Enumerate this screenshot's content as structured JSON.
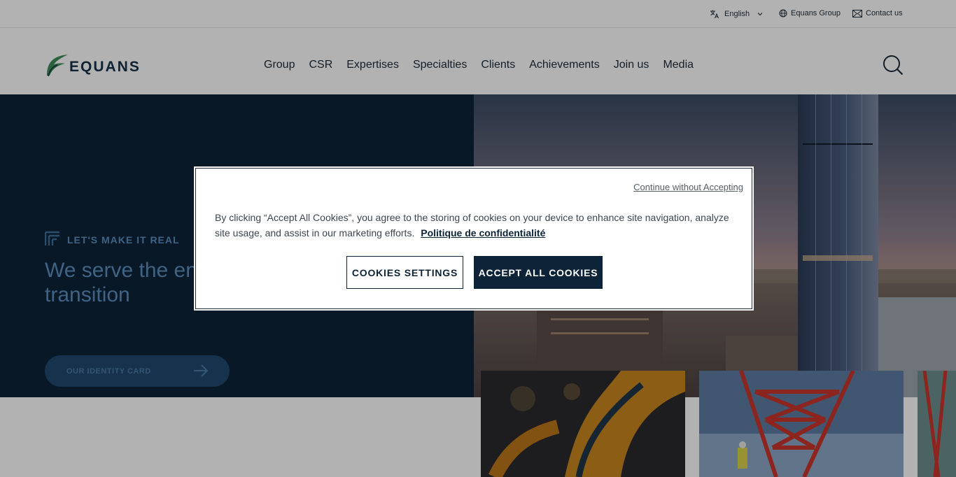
{
  "utility": {
    "language": "English",
    "group": "Equans Group",
    "contact": "Contact us"
  },
  "brand": {
    "name": "EQUANS",
    "green": "#3f8f5a",
    "navy": "#0d2338"
  },
  "nav": {
    "items": [
      "Group",
      "CSR",
      "Expertises",
      "Specialties",
      "Clients",
      "Achievements",
      "Join us",
      "Media"
    ]
  },
  "hero": {
    "tag": "LET'S MAKE IT REAL",
    "title": "We serve the energy and industrial transition",
    "cta": "OUR IDENTITY CARD"
  },
  "cookie": {
    "continue": "Continue without Accepting",
    "text": "By clicking “Accept All Cookies”, you agree to the storing of cookies on your device to enhance site navigation, analyze site usage, and assist in our marketing efforts.",
    "privacy_link": "Politique de confidentialité",
    "settings_button": "COOKIES SETTINGS",
    "accept_button": "ACCEPT ALL COOKIES"
  }
}
